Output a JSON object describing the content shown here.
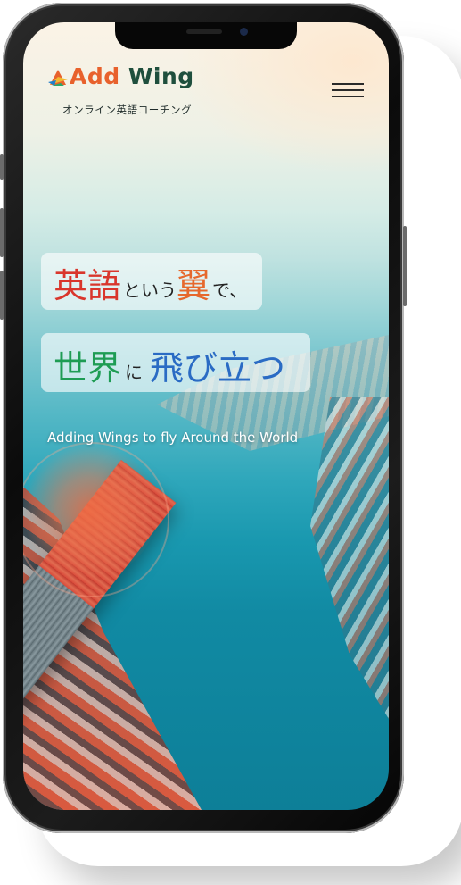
{
  "brand": {
    "name_part1": "Add",
    "name_part2": "Wing",
    "tagline": "オンライン英語コーチング"
  },
  "hero": {
    "line1": {
      "w1": "英語",
      "w2": "という",
      "w3": "翼",
      "w4": "で、"
    },
    "line2": {
      "w1": "世界",
      "w2": "に",
      "w3": "飛び立つ"
    },
    "subtitle": "Adding Wings  to fly Around the World"
  },
  "icons": {
    "logo": "add-wing-logo-icon",
    "menu": "hamburger-menu-icon"
  },
  "colors": {
    "add": "#e8612c",
    "wing": "#1f4f3d",
    "red": "#d9362c",
    "green": "#1e9c54",
    "blue": "#2a6bc4",
    "purple": "#6a4aa8"
  }
}
